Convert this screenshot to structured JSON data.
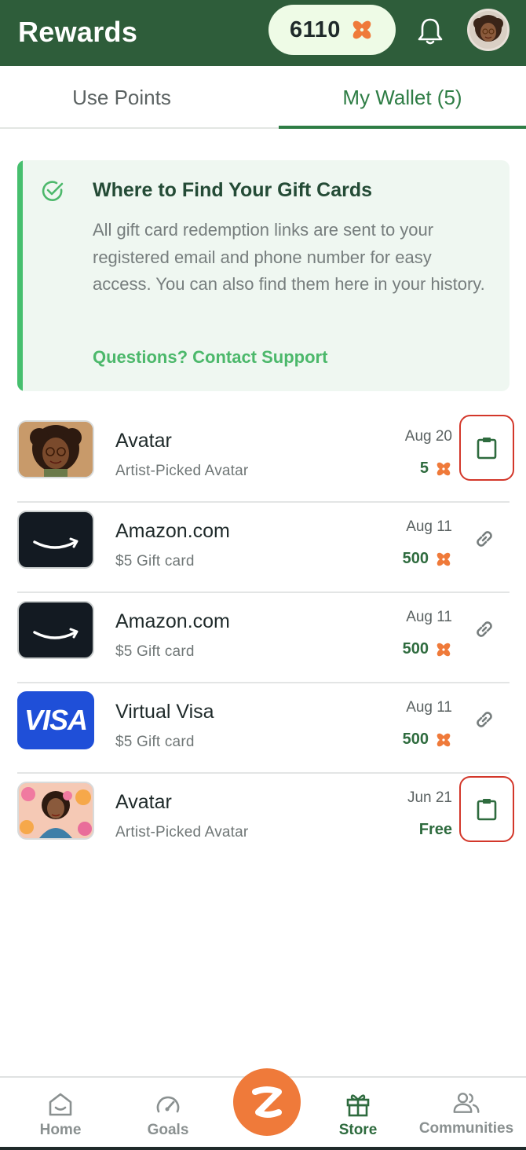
{
  "header": {
    "title": "Rewards",
    "points": "6110",
    "points_icon": "flower-icon",
    "notification_icon": "bell-icon"
  },
  "tabs": [
    {
      "label": "Use Points",
      "active": false
    },
    {
      "label": "My Wallet (5)",
      "active": true
    }
  ],
  "info_card": {
    "title": "Where to Find Your Gift Cards",
    "body": "All gift card redemption links are sent to your registered email and phone number for easy access. You can also find them here in your history.",
    "link": "Questions? Contact Support"
  },
  "wallet_items": [
    {
      "title": "Avatar",
      "subtitle": "Artist-Picked Avatar",
      "date": "Aug 20",
      "cost": "5",
      "action_icon": "clipboard-icon"
    },
    {
      "title": "Amazon.com",
      "subtitle": "$5 Gift card",
      "date": "Aug 11",
      "cost": "500",
      "action_icon": "link-icon"
    },
    {
      "title": "Amazon.com",
      "subtitle": "$5 Gift card",
      "date": "Aug 11",
      "cost": "500",
      "action_icon": "link-icon"
    },
    {
      "title": "Virtual Visa",
      "subtitle": "$5 Gift card",
      "date": "Aug 11",
      "cost": "500",
      "thumb_text": "VISA",
      "action_icon": "link-icon"
    },
    {
      "title": "Avatar",
      "subtitle": "Artist-Picked Avatar",
      "date": "Jun 21",
      "cost": "Free",
      "action_icon": "clipboard-icon"
    }
  ],
  "bottom_nav": [
    {
      "label": "Home",
      "icon": "home-icon"
    },
    {
      "label": "Goals",
      "icon": "gauge-icon"
    },
    {
      "label": "Store",
      "icon": "gift-icon",
      "active": true
    },
    {
      "label": "Communities",
      "icon": "people-icon"
    }
  ],
  "colors": {
    "header_bg": "#2e5d3a",
    "accent_green": "#2e7d45",
    "orange": "#ef7a3a",
    "highlight_red": "#d3372a"
  }
}
